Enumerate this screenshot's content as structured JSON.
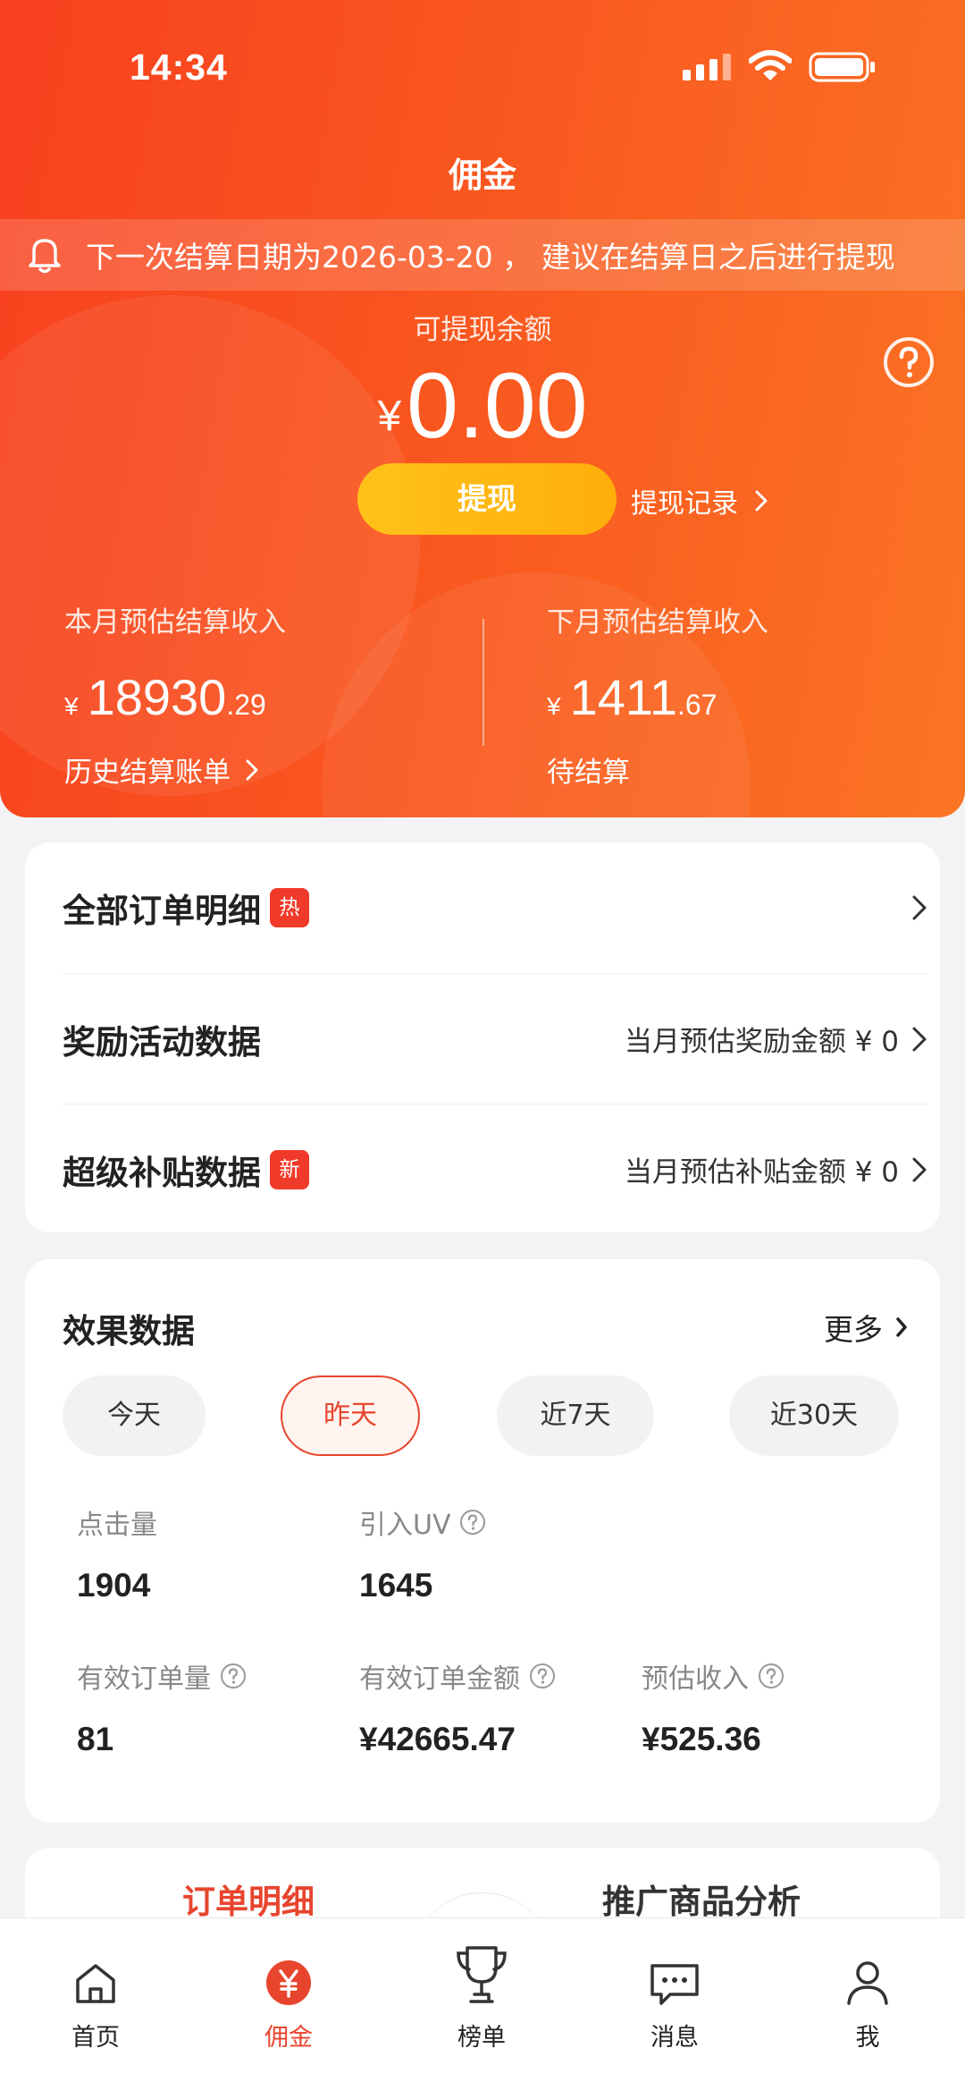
{
  "status_bar": {
    "time": "14:34"
  },
  "header": {
    "title": "佣金",
    "notice": "下一次结算日期为2026-03-20 ， 建议在结算日之后进行提现",
    "balance_label": "可提现余额",
    "balance_currency": "¥",
    "balance_amount": "0.00",
    "withdraw_label": "提现",
    "withdraw_record_label": "提现记录"
  },
  "settlement": {
    "this_month": {
      "title": "本月预估结算收入",
      "currency": "¥",
      "integer": "18930",
      "decimal": ".29",
      "link": "历史结算账单"
    },
    "next_month": {
      "title": "下月预估结算收入",
      "currency": "¥",
      "integer": "1411",
      "decimal": ".67",
      "link": "待结算"
    }
  },
  "menu": {
    "items": [
      {
        "title": "全部订单明细",
        "tag": "热",
        "right": ""
      },
      {
        "title": "奖励活动数据",
        "tag": "",
        "right": "当月预估奖励金额 ¥ 0"
      },
      {
        "title": "超级补贴数据",
        "tag": "新",
        "right": "当月预估补贴金额 ¥ 0"
      }
    ]
  },
  "performance": {
    "title": "效果数据",
    "more": "更多",
    "ranges": [
      "今天",
      "昨天",
      "近7天",
      "近30天"
    ],
    "selected_range": "昨天",
    "metrics": [
      {
        "label": "点击量",
        "value": "1904",
        "info": false
      },
      {
        "label": "引入UV",
        "value": "1645",
        "info": true
      },
      {
        "label": "有效订单量",
        "value": "81",
        "info": true
      },
      {
        "label": "有效订单金额",
        "value": "¥42665.47",
        "info": true
      },
      {
        "label": "预估收入",
        "value": "¥525.36",
        "info": true
      }
    ]
  },
  "detail_tabs": {
    "tabs": [
      "订单明细",
      "推广商品分析"
    ],
    "active": "订单明细"
  },
  "bottom_nav": {
    "items": [
      {
        "label": "首页",
        "icon": "home-icon"
      },
      {
        "label": "佣金",
        "icon": "yen-icon"
      },
      {
        "label": "榜单",
        "icon": "trophy-icon"
      },
      {
        "label": "消息",
        "icon": "message-icon"
      },
      {
        "label": "我",
        "icon": "person-icon"
      }
    ],
    "active": "佣金"
  },
  "colors": {
    "brand_orange": "#f9561f",
    "accent_red": "#e8452e",
    "withdraw_yellow": "#ffb812"
  }
}
